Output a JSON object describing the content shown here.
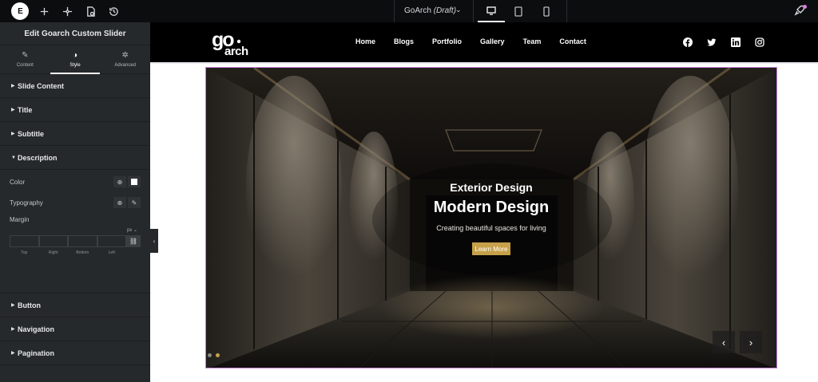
{
  "topbar": {
    "logo_text": "E",
    "icons": [
      "plus-icon",
      "structure-icon",
      "page-settings-icon",
      "history-icon"
    ],
    "document": {
      "name": "GoArch",
      "status": "(Draft)"
    },
    "devices": [
      "desktop-icon",
      "tablet-icon",
      "mobile-icon"
    ],
    "active_device": "desktop"
  },
  "panel": {
    "title": "Edit Goarch Custom Slider",
    "tabs": [
      {
        "label": "Content",
        "icon": "pencil-icon"
      },
      {
        "label": "Style",
        "icon": "contrast-icon"
      },
      {
        "label": "Advanced",
        "icon": "gear-icon"
      }
    ],
    "active_tab": "Style",
    "sections_before": [
      {
        "label": "Slide Content"
      },
      {
        "label": "Title"
      },
      {
        "label": "Subtitle"
      }
    ],
    "open_section": {
      "label": "Description",
      "color_label": "Color",
      "typography_label": "Typography",
      "margin_label": "Margin",
      "unit": "px",
      "margin_sides": [
        "Top",
        "Right",
        "Bottom",
        "Left"
      ]
    },
    "sections_after": [
      {
        "label": "Button"
      },
      {
        "label": "Navigation"
      },
      {
        "label": "Pagination"
      }
    ]
  },
  "site": {
    "logo": "goarch",
    "nav": [
      "Home",
      "Blogs",
      "Portfolio",
      "Gallery",
      "Team",
      "Contact"
    ],
    "socials": [
      "facebook-icon",
      "twitter-icon",
      "linkedin-icon",
      "instagram-icon"
    ]
  },
  "slide": {
    "subtitle": "Exterior Design",
    "title": "Modern Design",
    "description": "Creating beautiful spaces for living",
    "button": "Learn More",
    "prev": "‹",
    "next": "›",
    "pagination": {
      "count": 2,
      "active": 2
    }
  },
  "colors": {
    "accent": "#c6a14a",
    "panel": "#26292c",
    "topbar": "#0c0d0e",
    "header": "#000000",
    "selection": "#c27fd8"
  }
}
